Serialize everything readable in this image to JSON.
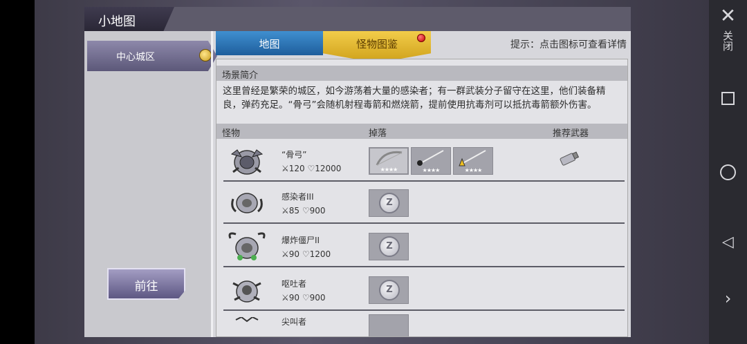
{
  "panel": {
    "title": "小地图"
  },
  "sidebar": {
    "district": "中心城区",
    "goto_button": "前往"
  },
  "tabs": [
    {
      "label": "地图",
      "active": false
    },
    {
      "label": "怪物图鉴",
      "active": true
    }
  ],
  "hint": "提示：点击图标可查看详情",
  "scene": {
    "heading": "场景简介",
    "description": "这里曾经是繁荣的城区，如今游荡着大量的感染者；有一群武装分子留守在这里，他们装备精良，弹药充足。“骨弓”会随机射程毒箭和燃烧箭，提前使用抗毒剂可以抵抗毒箭额外伤害。"
  },
  "table": {
    "headers": {
      "monster": "怪物",
      "drop": "掉落",
      "weapon": "推荐武器"
    },
    "rows": [
      {
        "name": "“骨弓”",
        "attack": "120",
        "hp": "12000",
        "drops": [
          "bow-item",
          "poison-arrow-item",
          "fire-arrow-item"
        ],
        "stars": "★★★★",
        "has_weapon": true
      },
      {
        "name": "感染者III",
        "attack": "85",
        "hp": "900",
        "drops": [
          "coin"
        ]
      },
      {
        "name": "爆炸僵尸II",
        "attack": "90",
        "hp": "1200",
        "drops": [
          "coin"
        ]
      },
      {
        "name": "呕吐者",
        "attack": "90",
        "hp": "900",
        "drops": [
          "coin"
        ]
      },
      {
        "name": "尖叫者",
        "attack": "",
        "hp": "",
        "drops": [
          "coin"
        ]
      }
    ]
  },
  "system_nav": {
    "close_label": "关闭",
    "close_glyph": "✕",
    "back_glyph": "◁",
    "next_glyph": "›"
  }
}
